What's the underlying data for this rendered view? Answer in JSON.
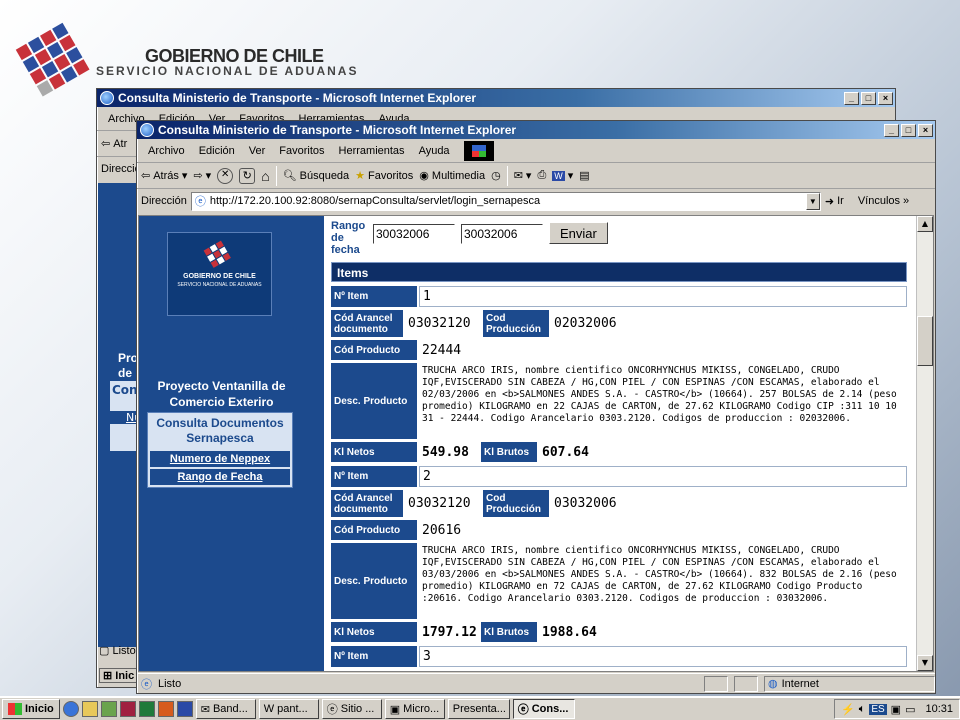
{
  "slide": {
    "title": "GOBIERNO DE CHILE",
    "subtitle": "SERVICIO NACIONAL DE ADUANAS"
  },
  "back_window": {
    "title": "Consulta Ministerio de Transporte - Microsoft Internet Explorer",
    "menu": [
      "Archivo",
      "Edición",
      "Ver",
      "Favoritos",
      "Herramientas",
      "Ayuda"
    ],
    "toolbar_back": "Atr",
    "address_label": "Direcció",
    "project_fragment": [
      "Pro",
      "de C"
    ],
    "box_fragment": "Con",
    "link_fragment": "Nu",
    "status": "Listo",
    "taskbar_start": "Inic"
  },
  "window": {
    "title": "Consulta Ministerio de Transporte - Microsoft Internet Explorer",
    "menu": [
      "Archivo",
      "Edición",
      "Ver",
      "Favoritos",
      "Herramientas",
      "Ayuda"
    ],
    "toolbar": {
      "back": "Atrás",
      "search": "Búsqueda",
      "favorites": "Favoritos",
      "multimedia": "Multimedia"
    },
    "address": {
      "label": "Dirección",
      "url": "http://172.20.100.92:8080/sernapConsulta/servlet/login_sernapesca",
      "go": "Ir",
      "links": "Vínculos"
    },
    "status": {
      "text": "Listo",
      "zone": "Internet"
    }
  },
  "page": {
    "logo_title": "GOBIERNO DE CHILE",
    "logo_sub": "SERVICIO NACIONAL DE ADUANAS",
    "project_title": "Proyecto Ventanilla de Comercio Exteriro",
    "menu_header": "Consulta Documentos Sernapesca",
    "links": [
      "Numero de Neppex",
      "Rango de Fecha"
    ],
    "rango_label": "Rango de fecha",
    "date_from": "30032006",
    "date_to": "30032006",
    "send_button": "Enviar",
    "items_header": "Items",
    "labels": {
      "item_no": "Nº Item",
      "cod_arancel": "Cód Arancel documento",
      "cod_produccion": "Cod Producción",
      "cod_producto": "Cód Producto",
      "desc_producto": "Desc. Producto",
      "kl_netos": "Kl Netos",
      "kl_brutos": "Kl Brutos"
    },
    "items": [
      {
        "item_no": "1",
        "cod_arancel": "03032120",
        "cod_produccion": "02032006",
        "cod_producto": "22444",
        "desc": "TRUCHA ARCO IRIS, nombre cientifico ONCORHYNCHUS MIKISS, CONGELADO, CRUDO IQF,EVISCERADO SIN CABEZA / HG,CON PIEL / CON ESPINAS /CON ESCAMAS, elaborado el 02/03/2006 en <b>SALMONES ANDES S.A. - CASTRO</b> (10664). 257 BOLSAS de 2.14 (peso promedio) KILOGRAMO en 22 CAJAS de CARTON, de 27.62 KILOGRAMO Codigo CIP :311 10 10 31 - 22444. Codigo Arancelario 0303.2120. Codigos de produccion : 02032006.",
        "kl_netos": "549.98",
        "kl_brutos": "607.64"
      },
      {
        "item_no": "2",
        "cod_arancel": "03032120",
        "cod_produccion": "03032006",
        "cod_producto": "20616",
        "desc": "TRUCHA ARCO IRIS, nombre cientifico ONCORHYNCHUS MIKISS, CONGELADO, CRUDO IQF,EVISCERADO SIN CABEZA / HG,CON PIEL / CON ESPINAS /CON ESCAMAS, elaborado el 03/03/2006 en <b>SALMONES ANDES S.A. - CASTRO</b> (10664). 832 BOLSAS de 2.16 (peso promedio) KILOGRAMO en 72 CAJAS de CARTON, de 27.62 KILOGRAMO Codigo Producto :20616. Codigo Arancelario 0303.2120. Codigos de produccion : 03032006.",
        "kl_netos": "1797.12",
        "kl_brutos": "1988.64"
      },
      {
        "item_no": "3"
      }
    ]
  },
  "taskbar": {
    "start": "Inicio",
    "tasks": [
      "Band...",
      "pant...",
      "Sitio ...",
      "Micro...",
      "Presenta...",
      "Cons..."
    ],
    "lang": "ES",
    "clock": "10:31"
  }
}
